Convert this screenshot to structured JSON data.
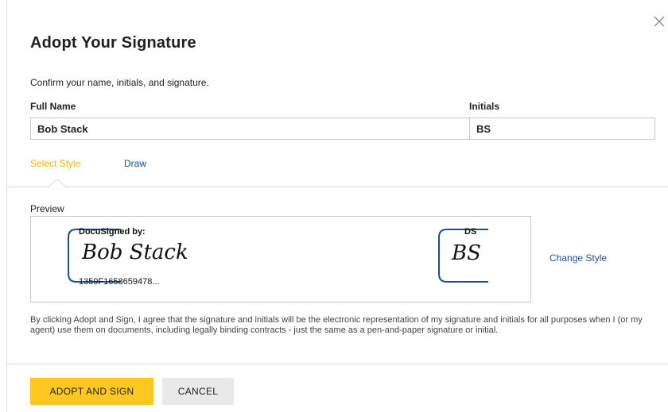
{
  "dialog": {
    "title": "Adopt Your Signature",
    "subtitle": "Confirm your name, initials, and signature.",
    "close_icon": "close-icon"
  },
  "form": {
    "full_name_label": "Full Name",
    "full_name_value": "Bob Stack",
    "initials_label": "Initials",
    "initials_value": "BS"
  },
  "tabs": [
    {
      "label": "Select Style",
      "active": true
    },
    {
      "label": "Draw",
      "active": false
    }
  ],
  "preview": {
    "label": "Preview",
    "signature": {
      "header": "DocuSigned by:",
      "text": "Bob Stack",
      "id": "1359F1658659478..."
    },
    "initials": {
      "header": "DS",
      "text": "BS"
    },
    "change_style_label": "Change Style"
  },
  "legal_text": "By clicking Adopt and Sign, I agree that the signature and initials will be the electronic representation of my signature and initials for all purposes when I (or my agent) use them on documents, including legally binding contracts - just the same as a pen-and-paper signature or initial.",
  "buttons": {
    "adopt_label": "ADOPT AND SIGN",
    "cancel_label": "CANCEL"
  },
  "colors": {
    "accent_yellow": "#ffc820",
    "active_tab": "#f5b900",
    "link_blue": "#1f4e9a",
    "signature_frame": "#1f4e9a"
  }
}
